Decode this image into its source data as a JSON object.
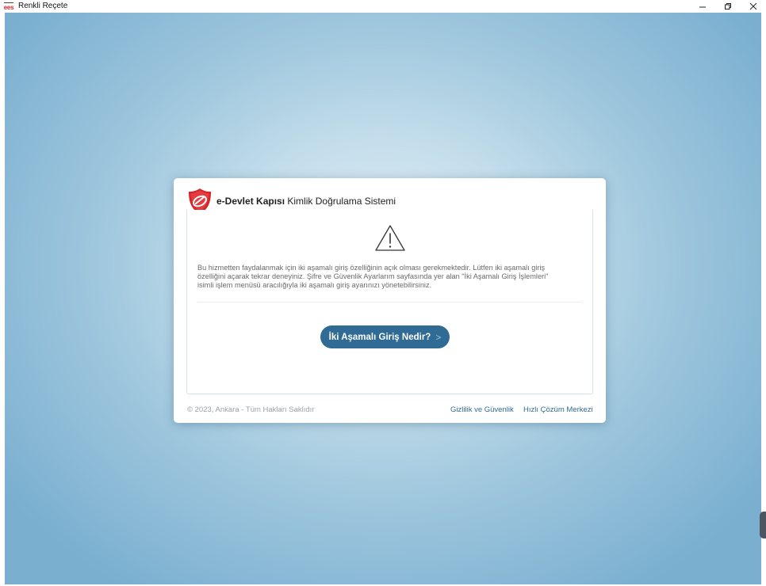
{
  "window": {
    "app_icon_text": "ees",
    "title": "Renkli Reçete"
  },
  "dialog": {
    "header_brand": "e-Devlet Kapısı",
    "header_subtitle": "Kimlik Doğrulama Sistemi",
    "message_lines": [
      "Bu hizmetten faydalanmak için iki aşamalı giriş özelliğinin açık olması gerekmektedir. Lütfen iki aşamalı giriş",
      "özelliğini açarak tekrar deneyiniz. Şifre ve Güvenlik Ayarlarım sayfasında yer alan \"İki Aşamalı Giriş İşlemleri\"",
      "isimli işlem menüsü aracılığıyla iki aşamalı giriş ayarınızı yönetebilirsiniz."
    ],
    "help_button_label": "İki Aşamalı Giriş Nedir?",
    "help_button_chevron": ">"
  },
  "footer": {
    "copyright": "© 2023, Ankara - Tüm Hakları Saklıdır",
    "links": [
      "Gizlilik ve Güvenlik",
      "Hızlı Çözüm Merkezi"
    ]
  },
  "icons": {
    "logo": "e-devlet-logo",
    "warning": "warning-triangle-icon",
    "minimize": "minimize-icon",
    "restore": "restore-icon",
    "close": "close-icon"
  },
  "colors": {
    "brand_red": "#d6262b",
    "button_blue": "#2f6b94",
    "link_blue": "#2f6b94",
    "background_light": "#e6f1f7",
    "background_dark": "#7aafd0"
  }
}
